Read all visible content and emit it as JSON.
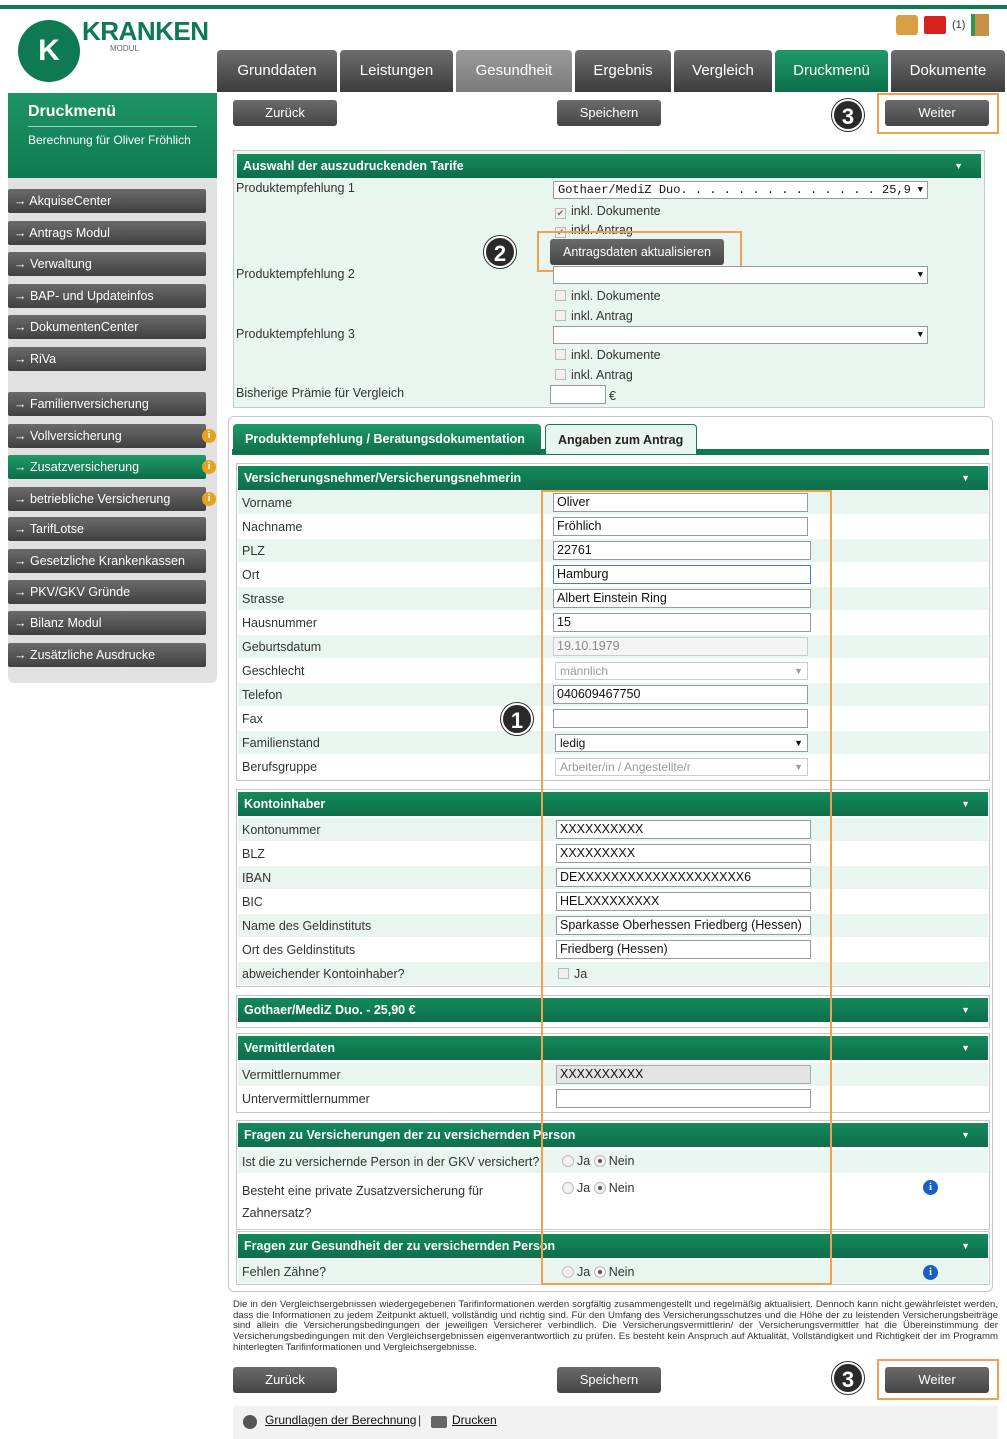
{
  "brand": {
    "logo_letter": "K",
    "name": "KRANKEN",
    "sub": "MODUL",
    "notif": "(1)"
  },
  "tabs": [
    "Grunddaten",
    "Leistungen",
    "Gesundheit",
    "Ergebnis",
    "Vergleich",
    "Druckmenü",
    "Dokumente"
  ],
  "sidebar": {
    "title": "Druckmenü",
    "subtitle": "Berechnung für Oliver Fröhlich",
    "items": [
      "AkquiseCenter",
      "Antrags Modul",
      "Verwaltung",
      "BAP- und Updateinfos",
      "DokumentenCenter",
      "RiVa",
      "Familienversicherung",
      "Vollversicherung",
      "Zusatzversicherung",
      "betriebliche Versicherung",
      "TarifLotse",
      "Gesetzliche Krankenkassen",
      "PKV/GKV Gründe",
      "Bilanz Modul",
      "Zusätzliche Ausdrucke"
    ],
    "arrow": "→",
    "info": "i"
  },
  "buttons": {
    "back": "Zurück",
    "save": "Speichern",
    "next": "Weiter",
    "update": "Antragsdaten aktualisieren"
  },
  "badges": [
    "1",
    "2",
    "3"
  ],
  "tarife": {
    "header": "Auswahl der auszudruckenden Tarife",
    "p1_label": "Produktempfehlung 1",
    "p1_value": "Gothaer/MediZ Duo. . . . . . . . . . . . . . 25,9",
    "p2_label": "Produktempfehlung 2",
    "p3_label": "Produktempfehlung 3",
    "incl_docs": "inkl. Dokumente",
    "incl_antrag": "inkl. Antrag",
    "praemie_label": "Bisherige Prämie für Vergleich",
    "euro": "€"
  },
  "subtabs": [
    "Produktempfehlung / Beratungsdokumentation",
    "Angaben zum Antrag"
  ],
  "vn": {
    "header": "Versicherungsnehmer/Versicherungsnehmerin",
    "fields": [
      {
        "label": "Vorname",
        "value": "Oliver"
      },
      {
        "label": "Nachname",
        "value": "Fröhlich"
      },
      {
        "label": "PLZ",
        "value": "22761"
      },
      {
        "label": "Ort",
        "value": "Hamburg"
      },
      {
        "label": "Strasse",
        "value": "Albert Einstein Ring"
      },
      {
        "label": "Hausnummer",
        "value": "15"
      },
      {
        "label": "Geburtsdatum",
        "value": "19.10.1979"
      },
      {
        "label": "Geschlecht",
        "value": "männlich"
      },
      {
        "label": "Telefon",
        "value": "040609467750"
      },
      {
        "label": "Fax",
        "value": ""
      },
      {
        "label": "Familienstand",
        "value": "ledig"
      },
      {
        "label": "Berufsgruppe",
        "value": "Arbeiter/in / Angestellte/r"
      }
    ]
  },
  "konto": {
    "header": "Kontoinhaber",
    "fields": [
      {
        "label": "Kontonummer",
        "value": "XXXXXXXXXX"
      },
      {
        "label": "BLZ",
        "value": "XXXXXXXXX"
      },
      {
        "label": "IBAN",
        "value": "DEXXXXXXXXXXXXXXXXXXXX6"
      },
      {
        "label": "BIC",
        "value": "HELXXXXXXXXX"
      },
      {
        "label": "Name des Geldinstituts",
        "value": "Sparkasse Oberhessen Friedberg (Hessen)"
      },
      {
        "label": "Ort des Geldinstituts",
        "value": "Friedberg (Hessen)"
      },
      {
        "label": "abweichender Kontoinhaber?",
        "value": "Ja"
      }
    ]
  },
  "gothaer": {
    "header": "Gothaer/MediZ Duo. - 25,90 €"
  },
  "vermittler": {
    "header": "Vermittlerdaten",
    "nr_label": "Vermittlernummer",
    "nr_value": "XXXXXXXXXX",
    "unter_label": "Untervermittlernummer"
  },
  "fragen_vers": {
    "header": "Fragen zu Versicherungen der zu versichernden Person",
    "q1": "Ist die zu versichernde Person in der GKV versichert?",
    "q2": "Besteht eine private Zusatzversicherung für Zahnersatz?",
    "yes": "Ja",
    "no": "Nein"
  },
  "fragen_ges": {
    "header": "Fragen zur Gesundheit der zu versichernden Person",
    "q1": "Fehlen Zähne?"
  },
  "disclaimer": "Die in den Vergleichsergebnissen wiedergegebenen Tarifinformationen werden sorgfältig zusammengestellt und regelmäßig aktualisiert. Dennoch kann nicht gewährleistet werden, dass die Informationen zu jedem Zeitpunkt aktuell, vollständig und richtig sind. Für den Umfang des Versicherungsschutzes und die Höhe der zu leistenden Versicherungsbeiträge sind allein die Versicherungsbedingungen der jeweiligen Versicherer verbindlich. Die Versicherungsvermittlerin/ der Versicherungsvermittler hat die Übereinstimmung der Versicherungsbedingungen mit den Vergleichsergebnissen eigenverantwortlich zu prüfen. Es besteht kein Anspruch auf Aktualität, Vollständigkeit und Richtigkeit der im Programm hinterlegten Tarifinformationen und Vergleichsergebnisse.",
  "footer": {
    "link1": "Grundlagen der Berechnung",
    "sep": "|",
    "link2": "Drucken"
  }
}
